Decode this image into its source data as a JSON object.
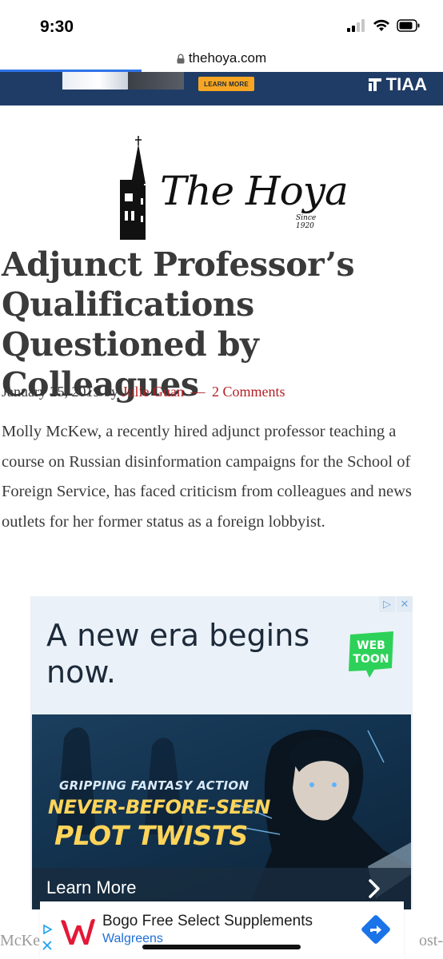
{
  "status_bar": {
    "time": "9:30",
    "icons": [
      "signal-icon",
      "wifi-icon",
      "battery-icon"
    ]
  },
  "browser": {
    "url": "thehoya.com",
    "load_progress": 0.32
  },
  "top_ad": {
    "button_label": "LEARN MORE",
    "brand": "TIAA"
  },
  "masthead": {
    "title": "The Hoya",
    "since": "Since 1920"
  },
  "article": {
    "headline": "Adjunct Professor’s Qualifications Questioned by Colleagues",
    "date": "January 25, 2019",
    "by_word": "by",
    "author": "Julie Guan",
    "separator": "—",
    "comments": "2 Comments",
    "lede": "Molly McKew, a recently hired adjunct professor teaching a course on Russian disinformation campaigns for the School of Foreign Service, has faced criticism from colleagues and news outlets for her former status as a foreign lobbyist."
  },
  "webtoon_ad": {
    "headline": "A new era begins now.",
    "logo_line1": "WEB",
    "logo_line2": "TOON",
    "tagline": "GRIPPING FANTASY ACTION",
    "line1": "NEVER-BEFORE-SEEN",
    "line2": "PLOT TWISTS",
    "cta": "Learn More",
    "colors": {
      "logo_green": "#2dd159",
      "headline": "#1c2a3a",
      "promo_yellow": "#ffd45a"
    }
  },
  "bottom_ad": {
    "title": "Bogo Free Select Supplements",
    "sponsor": "Walgreens",
    "behind_left": "McKe",
    "behind_right": "ost-",
    "colors": {
      "logo_red": "#e31837",
      "arrow_blue": "#1a73e8"
    }
  }
}
